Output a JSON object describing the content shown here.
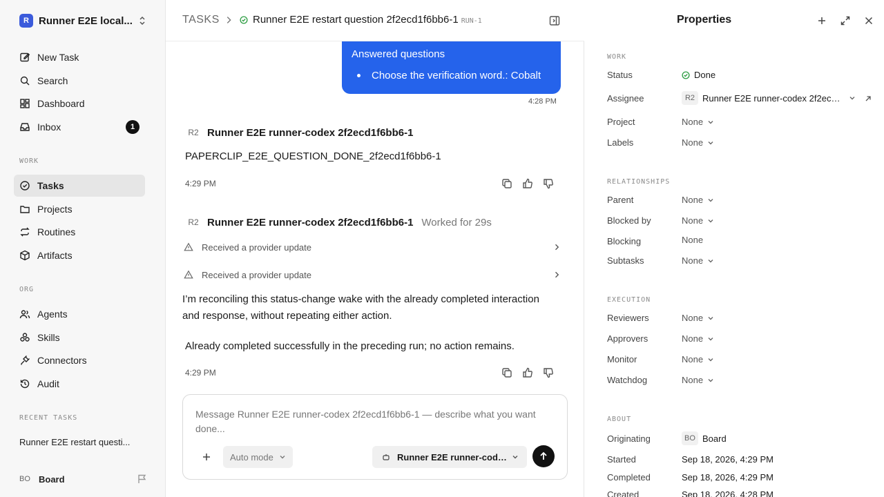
{
  "sidebar": {
    "workspace_logo": "R",
    "workspace_name": "Runner E2E local...",
    "nav": [
      {
        "label": "New Task",
        "icon": "edit-icon"
      },
      {
        "label": "Search",
        "icon": "search-icon"
      },
      {
        "label": "Dashboard",
        "icon": "dashboard-icon"
      },
      {
        "label": "Inbox",
        "icon": "inbox-icon",
        "badge": "1"
      }
    ],
    "work_label": "WORK",
    "work": [
      {
        "label": "Tasks",
        "icon": "check-circle-icon",
        "active": true
      },
      {
        "label": "Projects",
        "icon": "folder-icon"
      },
      {
        "label": "Routines",
        "icon": "repeat-icon"
      },
      {
        "label": "Artifacts",
        "icon": "box-icon"
      }
    ],
    "org_label": "ORG",
    "org": [
      {
        "label": "Agents",
        "icon": "users-icon"
      },
      {
        "label": "Skills",
        "icon": "skills-icon"
      },
      {
        "label": "Connectors",
        "icon": "plug-icon"
      },
      {
        "label": "Audit",
        "icon": "history-icon"
      }
    ],
    "recent_label": "RECENT TASKS",
    "recent_task": "Runner E2E restart questi...",
    "user_initials": "BO",
    "user_name": "Board"
  },
  "header": {
    "root": "TASKS",
    "title": "Runner E2E restart question 2f2ecd1f6bb6-1",
    "run_id": "RUN-1"
  },
  "thread": {
    "answered": {
      "title": "Answered questions",
      "item": "Choose the verification word.: Cobalt",
      "time": "4:28 PM"
    },
    "msg1": {
      "initials": "R2",
      "agent": "Runner E2E runner-codex 2f2ecd1f6bb6-1",
      "text": "PAPERCLIP_E2E_QUESTION_DONE_2f2ecd1f6bb6-1",
      "time": "4:29 PM"
    },
    "msg2": {
      "initials": "R2",
      "agent": "Runner E2E runner-codex 2f2ecd1f6bb6-1",
      "worked": "Worked for 29s",
      "updates": [
        "Received a provider update",
        "Received a provider update"
      ],
      "para1": "I’m reconciling this status-change wake with the already completed interaction and response, without repeating either action.",
      "para2": "Already completed successfully in the preceding run; no action remains.",
      "time": "4:29 PM"
    }
  },
  "composer": {
    "placeholder": "Message Runner E2E runner-codex 2f2ecd1f6bb6-1 — describe what you want done...",
    "mode": "Auto mode",
    "agent": "Runner E2E runner-codex..."
  },
  "properties": {
    "title": "Properties",
    "work_label": "WORK",
    "status_label": "Status",
    "status": "Done",
    "assignee_label": "Assignee",
    "assignee_initials": "R2",
    "assignee": "Runner E2E runner-codex 2f2ecd1...",
    "project_label": "Project",
    "project": "None",
    "labels_label": "Labels",
    "labels": "None",
    "rel_label": "RELATIONSHIPS",
    "parent_label": "Parent",
    "parent": "None",
    "blockedby_label": "Blocked by",
    "blockedby": "None",
    "blocking_label": "Blocking",
    "blocking": "None",
    "subtasks_label": "Subtasks",
    "subtasks": "None",
    "exec_label": "EXECUTION",
    "reviewers_label": "Reviewers",
    "reviewers": "None",
    "approvers_label": "Approvers",
    "approvers": "None",
    "monitor_label": "Monitor",
    "monitor": "None",
    "watchdog_label": "Watchdog",
    "watchdog": "None",
    "about_label": "ABOUT",
    "originating_label": "Originating",
    "originating_initials": "BO",
    "originating": "Board",
    "started_label": "Started",
    "started": "Sep 18, 2026, 4:29 PM",
    "completed_label": "Completed",
    "completed": "Sep 18, 2026, 4:29 PM",
    "created_label": "Created",
    "created": "Sep 18, 2026, 4:28 PM"
  },
  "colors": {
    "accent": "#2563eb",
    "status_done": "#2f9e44"
  }
}
